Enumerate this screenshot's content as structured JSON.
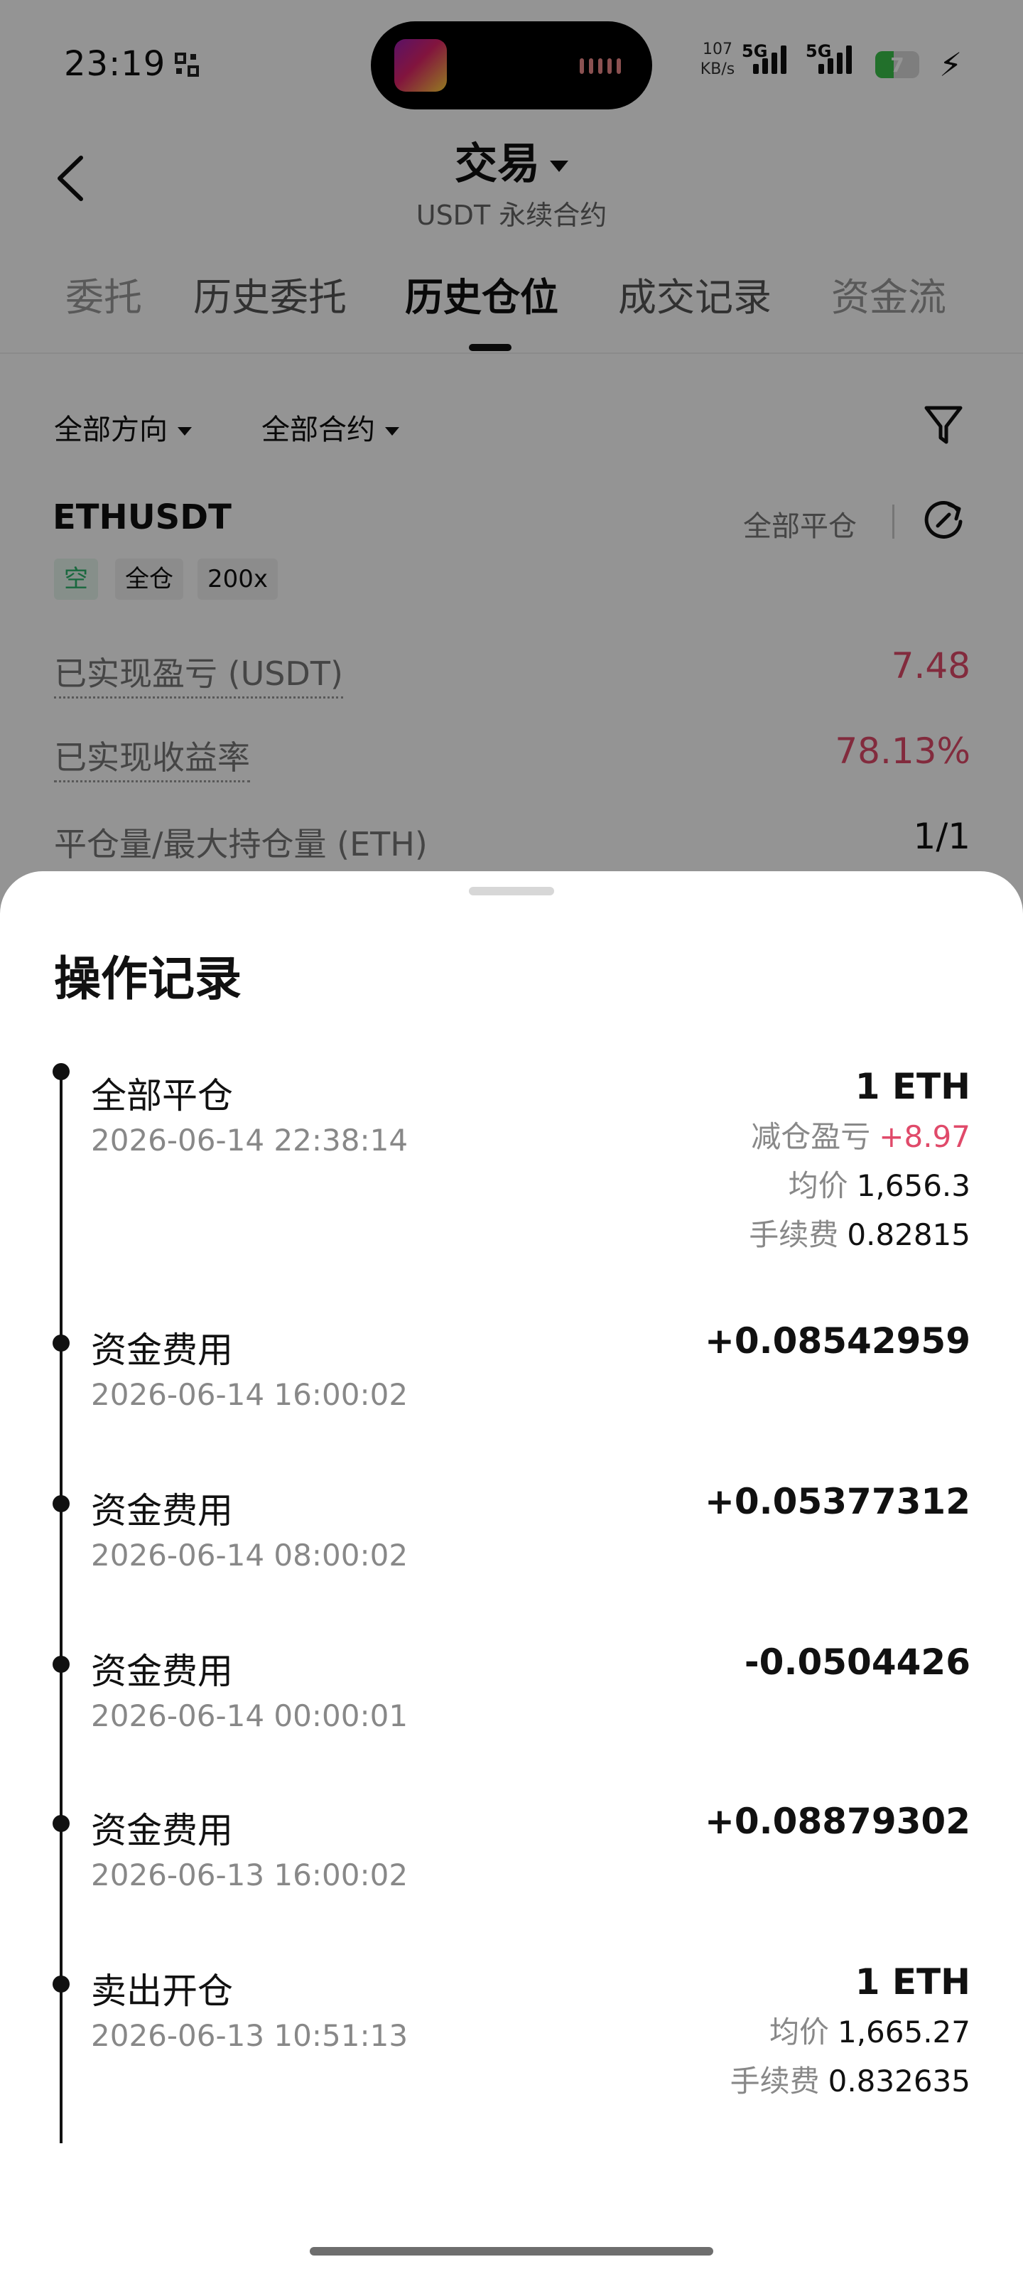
{
  "status_bar": {
    "time": "23:19",
    "net_speed_value": "107",
    "net_speed_unit": "KB/s",
    "signal1_label": "5G",
    "signal2_label": "5G",
    "battery_level": "7",
    "battery_color": "#3cc24a"
  },
  "header": {
    "title": "交易",
    "subtitle": "USDT 永续合约"
  },
  "tabs": [
    "委托",
    "历史委托",
    "历史仓位",
    "成交记录",
    "资金流"
  ],
  "active_tab_index": 2,
  "filters": {
    "direction": "全部方向",
    "contract": "全部合约"
  },
  "position": {
    "symbol": "ETHUSDT",
    "close_all_label": "全部平仓",
    "tags": [
      "空",
      "全仓",
      "200x"
    ],
    "stats": [
      {
        "label": "已实现盈亏 (USDT)",
        "value": "7.48"
      },
      {
        "label": "已实现收益率",
        "value": "78.13%"
      },
      {
        "label": "平仓量/最大持仓量 (ETH)",
        "value": "1/1"
      }
    ]
  },
  "sheet": {
    "title": "操作记录",
    "records": [
      {
        "type": "全部平仓",
        "time": "2026-06-14 22:38:14",
        "amount": "1 ETH",
        "pnl_label": "减仓盈亏",
        "pnl_value": "+8.97",
        "avg_label": "均价",
        "avg_value": "1,656.3",
        "fee_label": "手续费",
        "fee_value": "0.82815"
      },
      {
        "type": "资金费用",
        "time": "2026-06-14 16:00:02",
        "amount": "+0.08542959"
      },
      {
        "type": "资金费用",
        "time": "2026-06-14 08:00:02",
        "amount": "+0.05377312"
      },
      {
        "type": "资金费用",
        "time": "2026-06-14 00:00:01",
        "amount": "-0.0504426"
      },
      {
        "type": "资金费用",
        "time": "2026-06-13 16:00:02",
        "amount": "+0.08879302"
      },
      {
        "type": "卖出开仓",
        "time": "2026-06-13 10:51:13",
        "amount": "1 ETH",
        "avg_label": "均价",
        "avg_value": "1,665.27",
        "fee_label": "手续费",
        "fee_value": "0.832635"
      }
    ]
  },
  "colors": {
    "positive": "#e04a6a",
    "negative": "#27a86a",
    "accent_text": "#111111"
  },
  "icons": [
    "back-chevron-icon",
    "dropdown-caret-icon",
    "filter-funnel-icon",
    "refresh-icon",
    "qr-scan-icon",
    "charging-bolt-icon"
  ]
}
